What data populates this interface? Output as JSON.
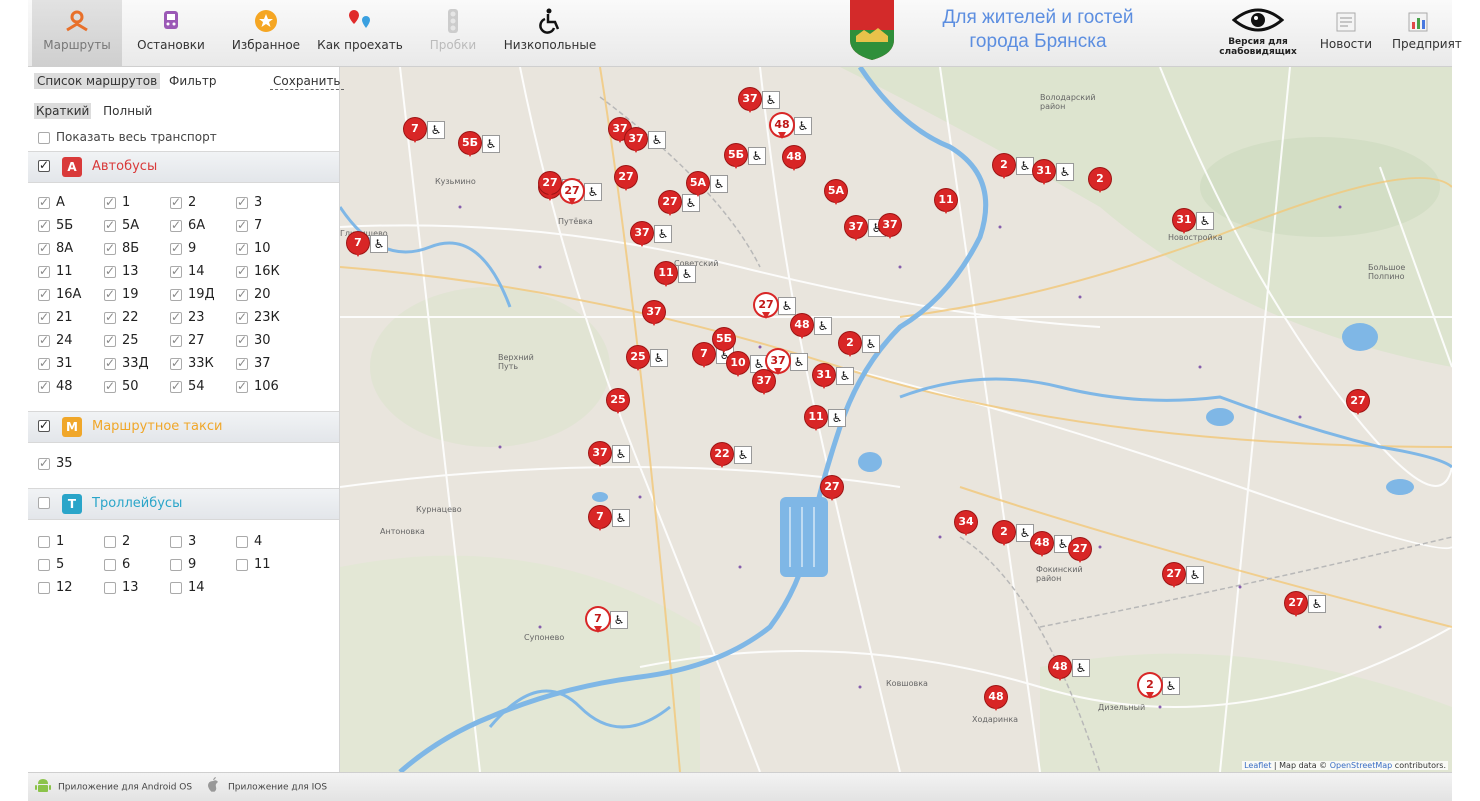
{
  "nav": {
    "routes": "Маршруты",
    "stops": "Остановки",
    "favorites": "Избранное",
    "directions": "Как проехать",
    "traffic": "Пробки",
    "lowfloor": "Низкопольные"
  },
  "header": {
    "title_line1": "Для жителей и гостей",
    "title_line2": "города Брянска",
    "vision_line1": "Версия для",
    "vision_line2": "слабовидящих",
    "news": "Новости",
    "business": "Предприятия"
  },
  "sidebar": {
    "tab_list": "Список маршрутов",
    "tab_filter": "Фильтр",
    "save": "Сохранить",
    "mode_short": "Краткий",
    "mode_full": "Полный",
    "show_all": "Показать весь транспорт",
    "buses": {
      "badge": "А",
      "title": "Автобусы",
      "color": "#d93a3a",
      "routes": [
        "А",
        "1",
        "2",
        "3",
        "5Б",
        "5А",
        "6А",
        "7",
        "8А",
        "8Б",
        "9",
        "10",
        "11",
        "13",
        "14",
        "16К",
        "16А",
        "19",
        "19Д",
        "20",
        "21",
        "22",
        "23",
        "23К",
        "24",
        "25",
        "27",
        "30",
        "31",
        "33Д",
        "33К",
        "37",
        "48",
        "50",
        "54",
        "106"
      ]
    },
    "taxi": {
      "badge": "М",
      "title": "Маршрутное такси",
      "color": "#f0a72a",
      "routes": [
        "35"
      ]
    },
    "trolley": {
      "badge": "Т",
      "title": "Троллейбусы",
      "color": "#2aa5c9",
      "routes": [
        "1",
        "2",
        "3",
        "4",
        "5",
        "6",
        "9",
        "11",
        "12",
        "13",
        "14"
      ]
    }
  },
  "map": {
    "places": {
      "kuzmino": "Кузьмино",
      "putevka": "Путёвка",
      "volodarsky": "Володарский район",
      "novostroyka": "Новостройка",
      "bolshoe_polpino": "Большое Полпино",
      "verkhny_put": "Верхний Путь",
      "kurnatsevo": "Курнацево",
      "antonovka": "Антоновка",
      "suponevo": "Супонево",
      "fokinsky": "Фокинский район",
      "kovshovka": "Ковшовка",
      "khodarinka": "Ходаринка",
      "dizelny": "Дизельный",
      "sovetsky": "Советский",
      "glinishchevo": "Глинищево"
    },
    "vehicles": [
      "7",
      "5Б",
      "37",
      "37",
      "48",
      "48",
      "2",
      "31",
      "2",
      "37",
      "5А",
      "11",
      "27",
      "27",
      "27",
      "27",
      "37",
      "5А",
      "5Б",
      "37",
      "37",
      "11",
      "27",
      "27",
      "48",
      "2",
      "37",
      "25",
      "7",
      "5Б",
      "10",
      "37",
      "37",
      "31",
      "11",
      "25",
      "37",
      "22",
      "27",
      "7",
      "7",
      "34",
      "2",
      "48",
      "27",
      "27",
      "27",
      "27",
      "31",
      "2",
      "48",
      "48",
      "7"
    ],
    "attribution_leaflet": "Leaflet",
    "attribution_text": "| Map data ©",
    "attribution_osm": "OpenStreetMap",
    "attribution_end": "contributors."
  },
  "footer": {
    "android": "Приложение для Android OS",
    "ios": "Приложение для IOS"
  }
}
